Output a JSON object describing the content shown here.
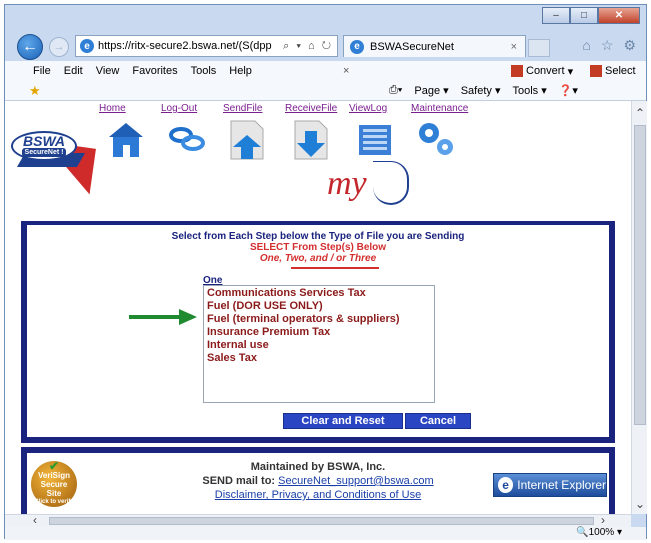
{
  "browser": {
    "address": "https://ritx-secure2.bswa.net/(S(dpp",
    "tab_title": "BSWASecureNet",
    "tab_close": "×",
    "addr_tools": "⌕ ▾ ⌂ ↻"
  },
  "menu": {
    "items": [
      "File",
      "Edit",
      "View",
      "Favorites",
      "Tools",
      "Help"
    ],
    "close_x": "×",
    "convert": "Convert",
    "select": "Select"
  },
  "commandbar": {
    "items": [
      "Page ▾",
      "Safety ▾",
      "Tools ▾"
    ]
  },
  "site": {
    "logo_text": "BSWA",
    "logo_sub": "SecureNet !",
    "nav": [
      "Home",
      "Log-Out",
      "SendFile",
      "ReceiveFile",
      "ViewLog",
      "Maintenance"
    ],
    "my_text": "my"
  },
  "form": {
    "instruction1": "Select from Each Step below the Type of File you are Sending",
    "instruction2": "SELECT From Step(s) Below",
    "instruction3": "One, Two, and / or Three",
    "step_label": "One",
    "options": [
      "Communications Services Tax",
      "Fuel (DOR USE ONLY)",
      "Fuel (terminal operators & suppliers)",
      "Insurance Premium Tax",
      "Internal use",
      "Sales Tax"
    ],
    "clear_button": "Clear and Reset",
    "cancel_button": "Cancel"
  },
  "footer": {
    "maintained": "Maintained by BSWA, Inc.",
    "send_prefix": "SEND mail to:",
    "email": "SecureNet_support@bswa.com",
    "disclaimer": "Disclaimer, Privacy, and Conditions of Use",
    "badge_line1": "VeriSign",
    "badge_line2": "Secure",
    "badge_line3": "Site",
    "badge_line4": "Click to verify",
    "ie_badge": "Internet Explorer"
  },
  "status": {
    "zoom": "100%"
  },
  "colors": {
    "panel_border": "#1a237e",
    "option_text": "#8b1a1a",
    "button_bg": "#2a46c2",
    "arrow": "#1f8a2f"
  }
}
